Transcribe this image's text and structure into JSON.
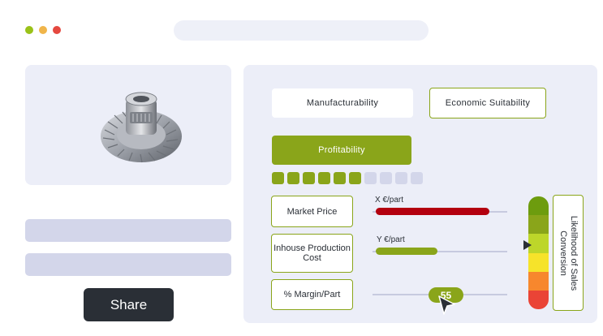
{
  "window": {
    "controls": [
      {
        "name": "close",
        "color": "#e5483f"
      },
      {
        "name": "minimize",
        "color": "#f0b54a"
      },
      {
        "name": "maximize",
        "color": "#9ac219"
      }
    ]
  },
  "product": {
    "image_icon": "bevel-gear-part"
  },
  "actions": {
    "share_label": "Share"
  },
  "tabs": {
    "manufacturability": "Manufacturability",
    "economic_suitability": "Economic Suitability",
    "profitability": "Profitability"
  },
  "profitability_score": {
    "filled": 6,
    "total": 10
  },
  "metrics": [
    {
      "label": "Market Price",
      "value_label": "X €/part",
      "level_percent": 85,
      "color": "#b3000f"
    },
    {
      "label": "Inhouse Production Cost",
      "value_label": "Y €/part",
      "level_percent": 46,
      "color": "#8aa51a"
    },
    {
      "label": "% Margin/Part",
      "slider_value": "55"
    }
  ],
  "likelihood": {
    "label": "Likelihood of Sales Conversion",
    "scale_colors": [
      "#6d9c0e",
      "#8aa51a",
      "#bdd62a",
      "#f6e32a",
      "#f7872d",
      "#ea4436"
    ],
    "marker_level": 2
  },
  "colors": {
    "accent": "#8aa51a",
    "panel": "#eceef8",
    "button_dark": "#2a2f36"
  }
}
